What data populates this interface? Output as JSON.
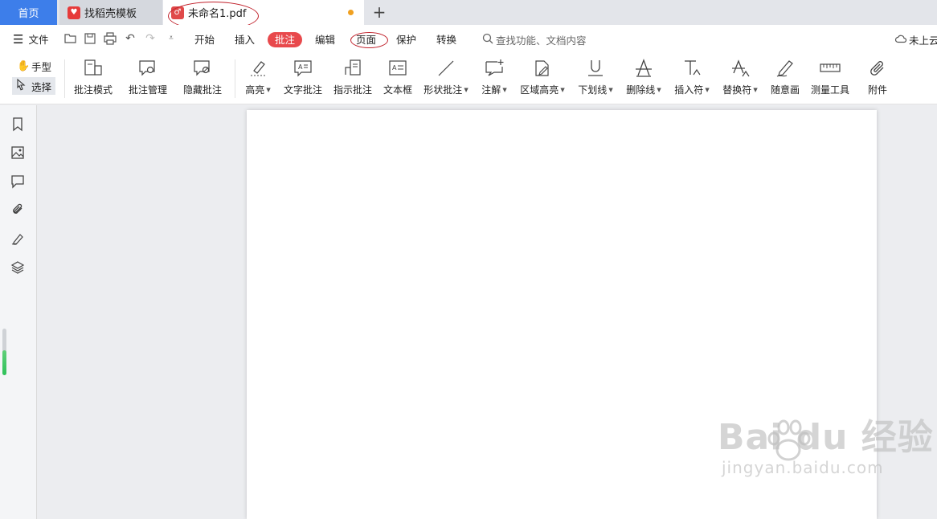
{
  "tabs": {
    "home": "首页",
    "tab1": "找稻壳模板",
    "tab2": "未命名1.pdf",
    "add_tab": "+"
  },
  "menu": {
    "file": "文件",
    "items": [
      "开始",
      "插入",
      "批注",
      "编辑",
      "页面",
      "保护",
      "转换"
    ],
    "active": "批注",
    "search_placeholder": "查找功能、文档内容",
    "cloud": "未上云"
  },
  "ribbon": {
    "hand": "手型",
    "select": "选择",
    "tools": [
      {
        "label": "批注模式",
        "icon": "annotation-mode-icon"
      },
      {
        "label": "批注管理",
        "icon": "annotation-manage-icon"
      },
      {
        "label": "隐藏批注",
        "icon": "hide-annotation-icon"
      },
      {
        "label": "高亮",
        "icon": "highlight-icon",
        "dropdown": true
      },
      {
        "label": "文字批注",
        "icon": "text-comment-icon"
      },
      {
        "label": "指示批注",
        "icon": "pointer-comment-icon"
      },
      {
        "label": "文本框",
        "icon": "textbox-icon"
      },
      {
        "label": "形状批注",
        "icon": "shape-comment-icon",
        "dropdown": true
      },
      {
        "label": "注解",
        "icon": "note-icon",
        "dropdown": true
      },
      {
        "label": "区域高亮",
        "icon": "area-highlight-icon",
        "dropdown": true
      },
      {
        "label": "下划线",
        "icon": "underline-icon",
        "dropdown": true
      },
      {
        "label": "删除线",
        "icon": "strikethrough-icon",
        "dropdown": true
      },
      {
        "label": "插入符",
        "icon": "insert-caret-icon",
        "dropdown": true
      },
      {
        "label": "替换符",
        "icon": "replace-caret-icon",
        "dropdown": true
      },
      {
        "label": "随意画",
        "icon": "freehand-icon"
      },
      {
        "label": "测量工具",
        "icon": "ruler-icon"
      },
      {
        "label": "附件",
        "icon": "attachment-icon"
      }
    ]
  },
  "sidebar": {
    "icons": [
      "bookmark-icon",
      "thumbnail-icon",
      "comment-icon",
      "attachment-icon",
      "signature-icon",
      "layers-icon"
    ]
  },
  "watermark": {
    "brand": "Bai du 经验",
    "url": "jingyan.baidu.com"
  },
  "colors": {
    "accent_blue": "#3d7eea",
    "active_red": "#e8494c",
    "annotation_ellipse": "#c0202a",
    "unsaved_dot": "#f0a020"
  }
}
